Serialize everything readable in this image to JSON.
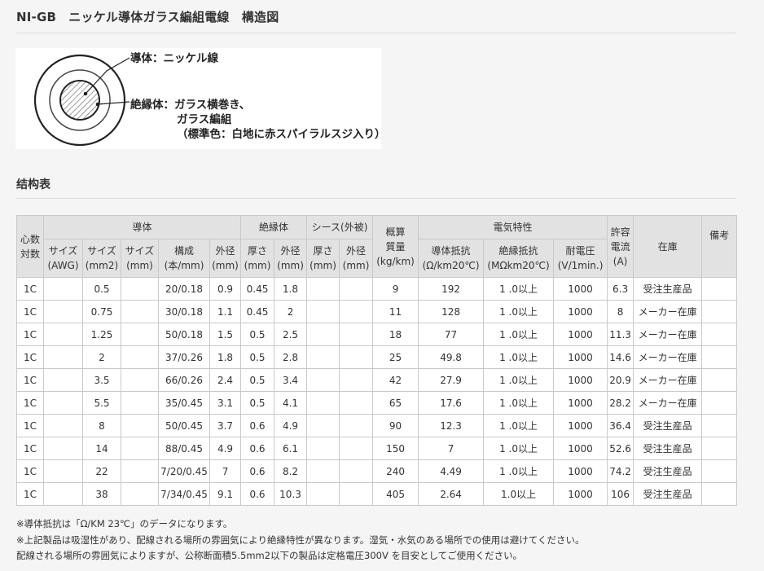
{
  "title": "NI-GB　ニッケル導体ガラス編組電線　構造図",
  "diagram": {
    "conductor_label": "導体：ニッケル線",
    "insulator_label_1": "絶縁体：ガラス横巻き、",
    "insulator_label_2": "ガラス編組",
    "insulator_label_3": "（標準色：白地に赤スパイラルスジ入り）"
  },
  "section_title": "结构表",
  "table": {
    "group_headers": {
      "cores": "心数\n対数",
      "conductor": "導体",
      "insulator": "絶縁体",
      "sheath": "シース(外被)",
      "weight": "概算\n質量\n(kg/km)",
      "electrical": "電気特性",
      "current": "許容\n電流\n(A)",
      "stock": "在庫",
      "remarks": "備考"
    },
    "sub_headers": {
      "size_awg": "サイズ\n(AWG)",
      "size_mm2": "サイズ\n(mm2)",
      "size_mm": "サイズ\n(mm)",
      "composition": "構成\n(本/mm)",
      "cond_od": "外径\n(mm)",
      "ins_thick": "厚さ\n(mm)",
      "ins_od": "外径\n(mm)",
      "sh_thick": "厚さ\n(mm)",
      "sh_od": "外径\n(mm)",
      "cond_res": "導体抵抗\n(Ω/km20℃)",
      "ins_res": "絶縁抵抗\n(MΩkm20℃)",
      "voltage": "耐電圧\n(V/1min.)"
    },
    "rows": [
      {
        "cores": "1C",
        "awg": "",
        "mm2": "0.5",
        "mm": "",
        "comp": "20/0.18",
        "cod": "0.9",
        "it": "0.45",
        "iod": "1.8",
        "st": "",
        "sod": "",
        "wt": "9",
        "cr": "192",
        "ir": "1 .0以上",
        "v": "1000",
        "a": "6.3",
        "stock": "受注生産品",
        "rem": ""
      },
      {
        "cores": "1C",
        "awg": "",
        "mm2": "0.75",
        "mm": "",
        "comp": "30/0.18",
        "cod": "1.1",
        "it": "0.45",
        "iod": "2",
        "st": "",
        "sod": "",
        "wt": "11",
        "cr": "128",
        "ir": "1 .0以上",
        "v": "1000",
        "a": "8",
        "stock": "メーカー在庫",
        "rem": ""
      },
      {
        "cores": "1C",
        "awg": "",
        "mm2": "1.25",
        "mm": "",
        "comp": "50/0.18",
        "cod": "1.5",
        "it": "0.5",
        "iod": "2.5",
        "st": "",
        "sod": "",
        "wt": "18",
        "cr": "77",
        "ir": "1 .0以上",
        "v": "1000",
        "a": "11.3",
        "stock": "メーカー在庫",
        "rem": ""
      },
      {
        "cores": "1C",
        "awg": "",
        "mm2": "2",
        "mm": "",
        "comp": "37/0.26",
        "cod": "1.8",
        "it": "0.5",
        "iod": "2.8",
        "st": "",
        "sod": "",
        "wt": "25",
        "cr": "49.8",
        "ir": "1 .0以上",
        "v": "1000",
        "a": "14.6",
        "stock": "メーカー在庫",
        "rem": ""
      },
      {
        "cores": "1C",
        "awg": "",
        "mm2": "3.5",
        "mm": "",
        "comp": "66/0.26",
        "cod": "2.4",
        "it": "0.5",
        "iod": "3.4",
        "st": "",
        "sod": "",
        "wt": "42",
        "cr": "27.9",
        "ir": "1 .0以上",
        "v": "1000",
        "a": "20.9",
        "stock": "メーカー在庫",
        "rem": ""
      },
      {
        "cores": "1C",
        "awg": "",
        "mm2": "5.5",
        "mm": "",
        "comp": "35/0.45",
        "cod": "3.1",
        "it": "0.5",
        "iod": "4.1",
        "st": "",
        "sod": "",
        "wt": "65",
        "cr": "17.6",
        "ir": "1 .0以上",
        "v": "1000",
        "a": "28.2",
        "stock": "メーカー在庫",
        "rem": ""
      },
      {
        "cores": "1C",
        "awg": "",
        "mm2": "8",
        "mm": "",
        "comp": "50/0.45",
        "cod": "3.7",
        "it": "0.6",
        "iod": "4.9",
        "st": "",
        "sod": "",
        "wt": "90",
        "cr": "12.3",
        "ir": "1 .0以上",
        "v": "1000",
        "a": "36.4",
        "stock": "受注生産品",
        "rem": ""
      },
      {
        "cores": "1C",
        "awg": "",
        "mm2": "14",
        "mm": "",
        "comp": "88/0.45",
        "cod": "4.9",
        "it": "0.6",
        "iod": "6.1",
        "st": "",
        "sod": "",
        "wt": "150",
        "cr": "7",
        "ir": "1 .0以上",
        "v": "1000",
        "a": "52.6",
        "stock": "受注生産品",
        "rem": ""
      },
      {
        "cores": "1C",
        "awg": "",
        "mm2": "22",
        "mm": "",
        "comp": "7/20/0.45",
        "cod": "7",
        "it": "0.6",
        "iod": "8.2",
        "st": "",
        "sod": "",
        "wt": "240",
        "cr": "4.49",
        "ir": "1 .0以上",
        "v": "1000",
        "a": "74.2",
        "stock": "受注生産品",
        "rem": ""
      },
      {
        "cores": "1C",
        "awg": "",
        "mm2": "38",
        "mm": "",
        "comp": "7/34/0.45",
        "cod": "9.1",
        "it": "0.6",
        "iod": "10.3",
        "st": "",
        "sod": "",
        "wt": "405",
        "cr": "2.64",
        "ir": "1.0以上",
        "v": "1000",
        "a": "106",
        "stock": "受注生産品",
        "rem": ""
      }
    ]
  },
  "notes": [
    "※導体抵抗は「Ω/KM 23℃」のデータになります。",
    "※上記製品は吸湿性があり、配線される場所の雰囲気により絶縁特性が異なります。湿気・水気のある場所での使用は避けてください。",
    "配線される場所の雰囲気によりますが、公称断面積5.5mm2以下の製品は定格電圧300V を目安としてご使用ください。"
  ]
}
